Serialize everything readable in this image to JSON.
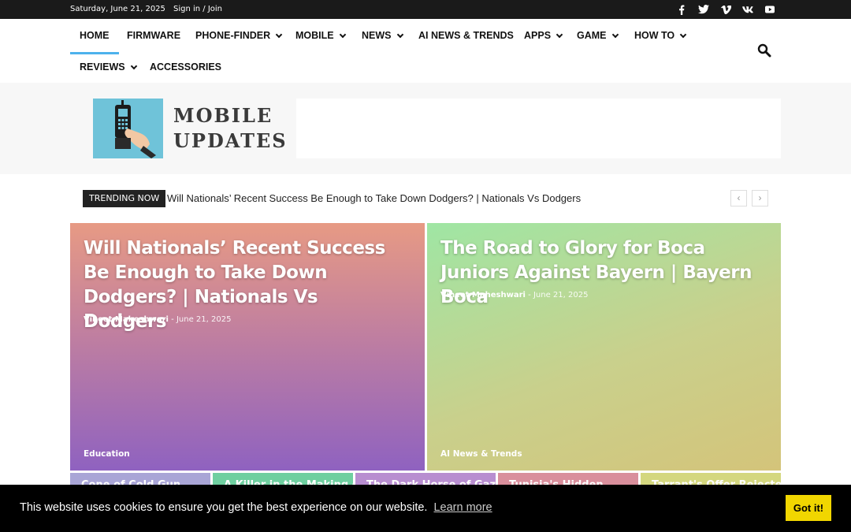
{
  "topbar": {
    "date": "Saturday, June 21, 2025",
    "signin": "Sign in / Join",
    "socials": [
      "facebook-icon",
      "twitter-icon",
      "vimeo-icon",
      "vk-icon",
      "youtube-icon"
    ]
  },
  "nav": {
    "items": [
      {
        "label": "HOME",
        "dropdown": false,
        "active": true
      },
      {
        "label": "FIRMWARE",
        "dropdown": false
      },
      {
        "label": "PHONE-FINDER",
        "dropdown": true
      },
      {
        "label": "MOBILE",
        "dropdown": true
      },
      {
        "label": "NEWS",
        "dropdown": true
      },
      {
        "label": "AI NEWS & TRENDS",
        "dropdown": false
      },
      {
        "label": "APPS",
        "dropdown": true
      },
      {
        "label": "GAME",
        "dropdown": true
      },
      {
        "label": "HOW TO",
        "dropdown": true
      },
      {
        "label": "REVIEWS",
        "dropdown": true
      },
      {
        "label": "ACCESSORIES",
        "dropdown": false
      }
    ]
  },
  "logo": {
    "line1": "MOBILE",
    "line2": "UPDATES"
  },
  "trending": {
    "label": "TRENDING NOW",
    "headline": "Will Nationals’ Recent Success Be Enough to Take Down Dodgers? | Nationals Vs Dodgers",
    "prev": "‹",
    "next": "›"
  },
  "featured": [
    {
      "title": "Will Nationals’ Recent Success Be Enough to Take Down Dodgers? | Nationals Vs Dodgers",
      "author": "Vineet Maheshwari",
      "date": "June 21, 2025",
      "category": "Education"
    },
    {
      "title": "The Road to Glory for Boca Juniors Against Bayern | Bayern Boca",
      "author": "Vineet Maheshwari",
      "date": "June 21, 2025",
      "category": "AI News & Trends"
    }
  ],
  "small_posts": [
    {
      "title": "Cone of Cold Gun",
      "color": "#a9a5d6"
    },
    {
      "title": "A Killer in the Making of",
      "color": "#6fcfa0"
    },
    {
      "title": "The Dark Horse of Gaza",
      "color": "#b88ed0"
    },
    {
      "title": "Tunisia's Hidden",
      "color": "#d98f9c"
    },
    {
      "title": "Tarrant's Offer Rejected",
      "color": "#d4d77f"
    }
  ],
  "cookie": {
    "message": "This website uses cookies to ensure you get the best experience on our website.",
    "learn_more": "Learn more",
    "button": "Got it!"
  },
  "colors": {
    "accent": "#4db2ec",
    "cookie_button": "#f1d600"
  }
}
